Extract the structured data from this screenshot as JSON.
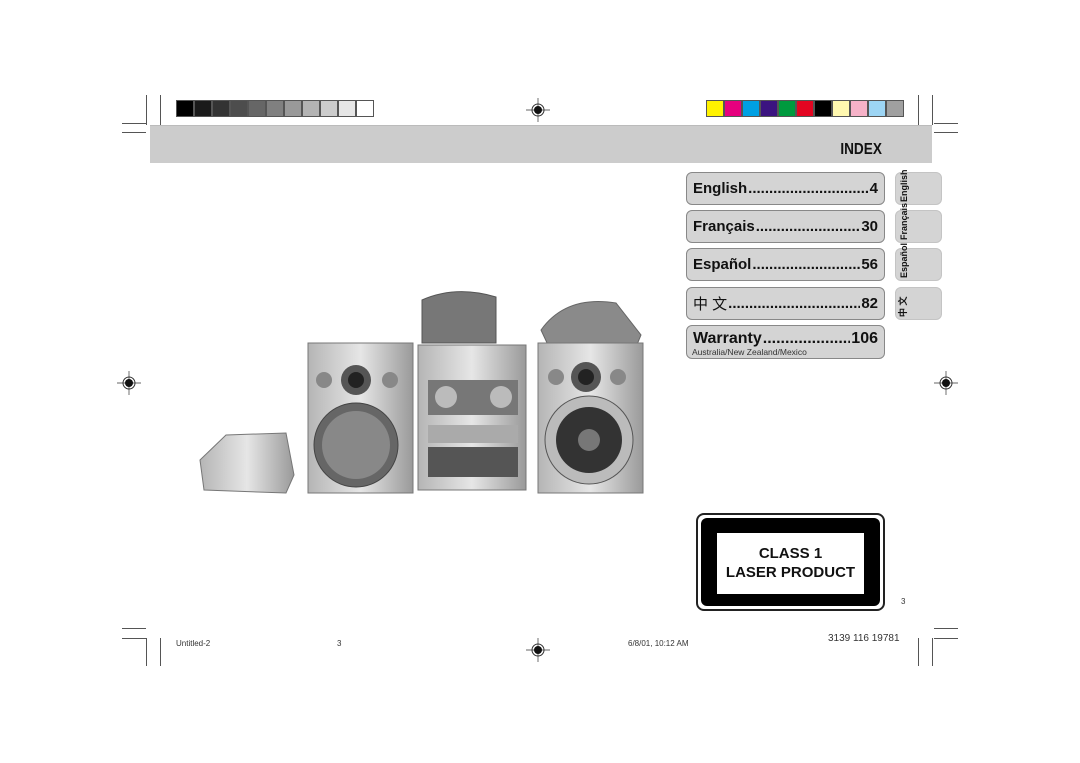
{
  "header": {
    "title": "INDEX"
  },
  "color_bars": {
    "grays": [
      "#000000",
      "#1a1a1a",
      "#333333",
      "#4d4d4d",
      "#666666",
      "#808080",
      "#999999",
      "#b3b3b3",
      "#cccccc",
      "#e6e6e6",
      "#ffffff"
    ],
    "colors": [
      "#fff200",
      "#e6007e",
      "#00a0e3",
      "#3b1480",
      "#009a3e",
      "#e30521",
      "#000000",
      "#fff8b0",
      "#f6b2c8",
      "#9dd5f4",
      "#a0a0a0"
    ]
  },
  "index": {
    "entries": [
      {
        "label": "English",
        "page": "4"
      },
      {
        "label": "Français",
        "page": "30"
      },
      {
        "label": "Español",
        "page": "56"
      },
      {
        "label": "中 文",
        "page": "82"
      },
      {
        "label": "Warranty",
        "page": "106",
        "sub": "Australia/New Zealand/Mexico"
      }
    ],
    "tabs": [
      "English",
      "Français",
      "Español",
      "中 文"
    ]
  },
  "laser": {
    "line1": "CLASS 1",
    "line2": "LASER PRODUCT"
  },
  "page_number": "3",
  "footer": {
    "file": "Untitled-2",
    "page": "3",
    "date": "6/8/01, 10:12 AM",
    "code": "3139 116 19781"
  }
}
